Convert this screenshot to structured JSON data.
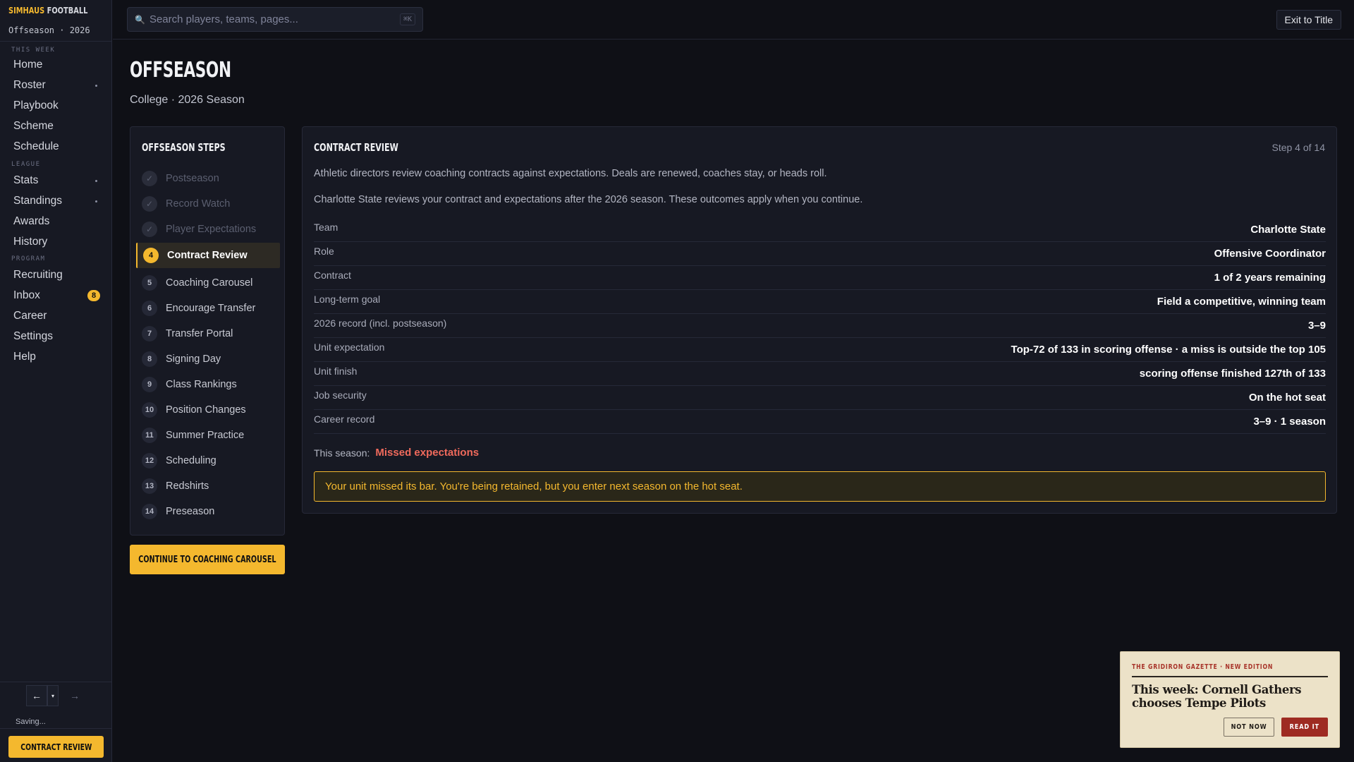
{
  "brand": {
    "name_accent": "SIMHAUS",
    "name_rest": " FOOTBALL",
    "subtitle": "Offseason · 2026"
  },
  "sidebar": {
    "sections": [
      {
        "label": "THIS WEEK",
        "items": [
          {
            "label": "Home",
            "dot": false
          },
          {
            "label": "Roster",
            "dot": true
          },
          {
            "label": "Playbook",
            "dot": false
          },
          {
            "label": "Scheme",
            "dot": false
          },
          {
            "label": "Schedule",
            "dot": false
          }
        ]
      },
      {
        "label": "LEAGUE",
        "items": [
          {
            "label": "Stats",
            "dot": true
          },
          {
            "label": "Standings",
            "dot": true
          },
          {
            "label": "Awards",
            "dot": false
          },
          {
            "label": "History",
            "dot": false
          }
        ]
      },
      {
        "label": "PROGRAM",
        "items": [
          {
            "label": "Recruiting",
            "dot": false
          },
          {
            "label": "Inbox",
            "badge": "8"
          },
          {
            "label": "Career",
            "dot": false
          },
          {
            "label": "Settings",
            "dot": false
          },
          {
            "label": "Help",
            "dot": false
          }
        ]
      }
    ],
    "history": {
      "back": "←",
      "menu": "▾",
      "forward": "→"
    },
    "saving": "Saving...",
    "cta": "CONTRACT REVIEW"
  },
  "topbar": {
    "search_placeholder": "Search players, teams, pages...",
    "search_icon": "🔍",
    "shortcut": "⌘K",
    "exit_label": "Exit to Title"
  },
  "page": {
    "title": "OFFSEASON",
    "subtitle": "College · 2026 Season"
  },
  "steps_panel": {
    "title": "OFFSEASON STEPS",
    "steps": [
      {
        "n": "✓",
        "label": "Postseason",
        "state": "done"
      },
      {
        "n": "✓",
        "label": "Record Watch",
        "state": "done"
      },
      {
        "n": "✓",
        "label": "Player Expectations",
        "state": "done"
      },
      {
        "n": "4",
        "label": "Contract Review",
        "state": "active"
      },
      {
        "n": "5",
        "label": "Coaching Carousel",
        "state": "todo"
      },
      {
        "n": "6",
        "label": "Encourage Transfer",
        "state": "todo"
      },
      {
        "n": "7",
        "label": "Transfer Portal",
        "state": "todo"
      },
      {
        "n": "8",
        "label": "Signing Day",
        "state": "todo"
      },
      {
        "n": "9",
        "label": "Class Rankings",
        "state": "todo"
      },
      {
        "n": "10",
        "label": "Position Changes",
        "state": "todo"
      },
      {
        "n": "11",
        "label": "Summer Practice",
        "state": "todo"
      },
      {
        "n": "12",
        "label": "Scheduling",
        "state": "todo"
      },
      {
        "n": "13",
        "label": "Redshirts",
        "state": "todo"
      },
      {
        "n": "14",
        "label": "Preseason",
        "state": "todo"
      }
    ],
    "continue_label": "CONTINUE TO COACHING CAROUSEL"
  },
  "contract": {
    "title": "CONTRACT REVIEW",
    "step_count": "Step 4 of 14",
    "intro": "Athletic directors review coaching contracts against expectations. Deals are renewed, coaches stay, or heads roll.",
    "detail": "Charlotte State reviews your contract and expectations after the 2026 season. These outcomes apply when you continue.",
    "rows": [
      {
        "k": "Team",
        "v": "Charlotte State"
      },
      {
        "k": "Role",
        "v": "Offensive Coordinator"
      },
      {
        "k": "Contract",
        "v": "1 of 2 years remaining"
      },
      {
        "k": "Long-term goal",
        "v": "Field a competitive, winning team"
      },
      {
        "k": "2026 record (incl. postseason)",
        "v": "3–9"
      },
      {
        "k": "Unit expectation",
        "v": "Top-72 of 133 in scoring offense · a miss is outside the top 105"
      },
      {
        "k": "Unit finish",
        "v": "scoring offense finished 127th of 133"
      },
      {
        "k": "Job security",
        "v": "On the hot seat"
      },
      {
        "k": "Career record",
        "v": "3–9 · 1 season"
      }
    ],
    "season_label": "This season:",
    "season_result": "Missed expectations",
    "notice": "Your unit missed its bar. You're being retained, but you enter next season on the hot seat."
  },
  "gazette": {
    "kicker": "THE GRIDIRON GAZETTE · NEW EDITION",
    "headline": "This week: Cornell Gathers chooses Tempe Pilots",
    "not_now": "NOT NOW",
    "read_it": "READ IT"
  }
}
